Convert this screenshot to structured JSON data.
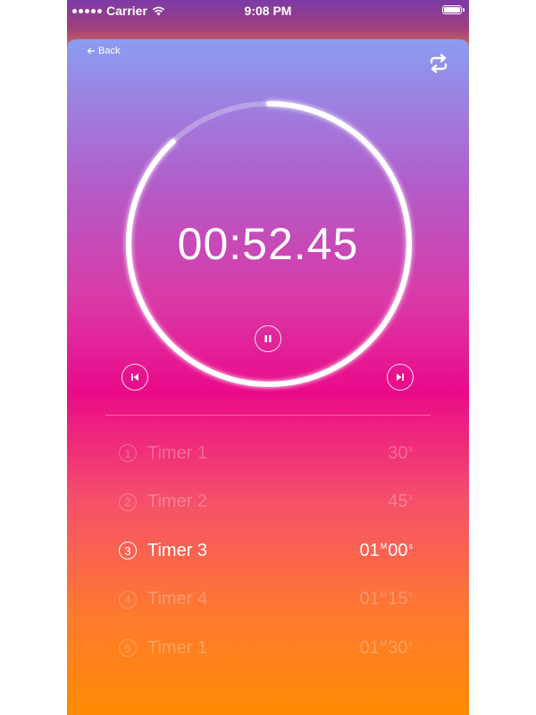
{
  "status_bar": {
    "carrier": "Carrier",
    "time": "9:08 PM"
  },
  "header": {
    "back_label": "Back"
  },
  "timer": {
    "display": "00:52.45",
    "progress": 0.88
  },
  "timers": [
    {
      "index": "1",
      "name": "Timer 1",
      "duration": [
        {
          "v": "30",
          "u": "s"
        }
      ],
      "active": false
    },
    {
      "index": "2",
      "name": "Timer 2",
      "duration": [
        {
          "v": "45",
          "u": "s"
        }
      ],
      "active": false
    },
    {
      "index": "3",
      "name": "Timer 3",
      "duration": [
        {
          "v": "01",
          "u": "M"
        },
        {
          "v": "00",
          "u": "s"
        }
      ],
      "active": true
    },
    {
      "index": "4",
      "name": "Timer 4",
      "duration": [
        {
          "v": "01",
          "u": "M"
        },
        {
          "v": "15",
          "u": "s"
        }
      ],
      "active": false
    },
    {
      "index": "5",
      "name": "Timer 1",
      "duration": [
        {
          "v": "01",
          "u": "M"
        },
        {
          "v": "30",
          "u": "s"
        }
      ],
      "active": false
    }
  ],
  "icons": {
    "back": "arrow-left-icon",
    "repeat": "repeat-icon",
    "pause": "pause-icon",
    "previous": "skip-previous-icon",
    "next": "skip-next-icon"
  }
}
